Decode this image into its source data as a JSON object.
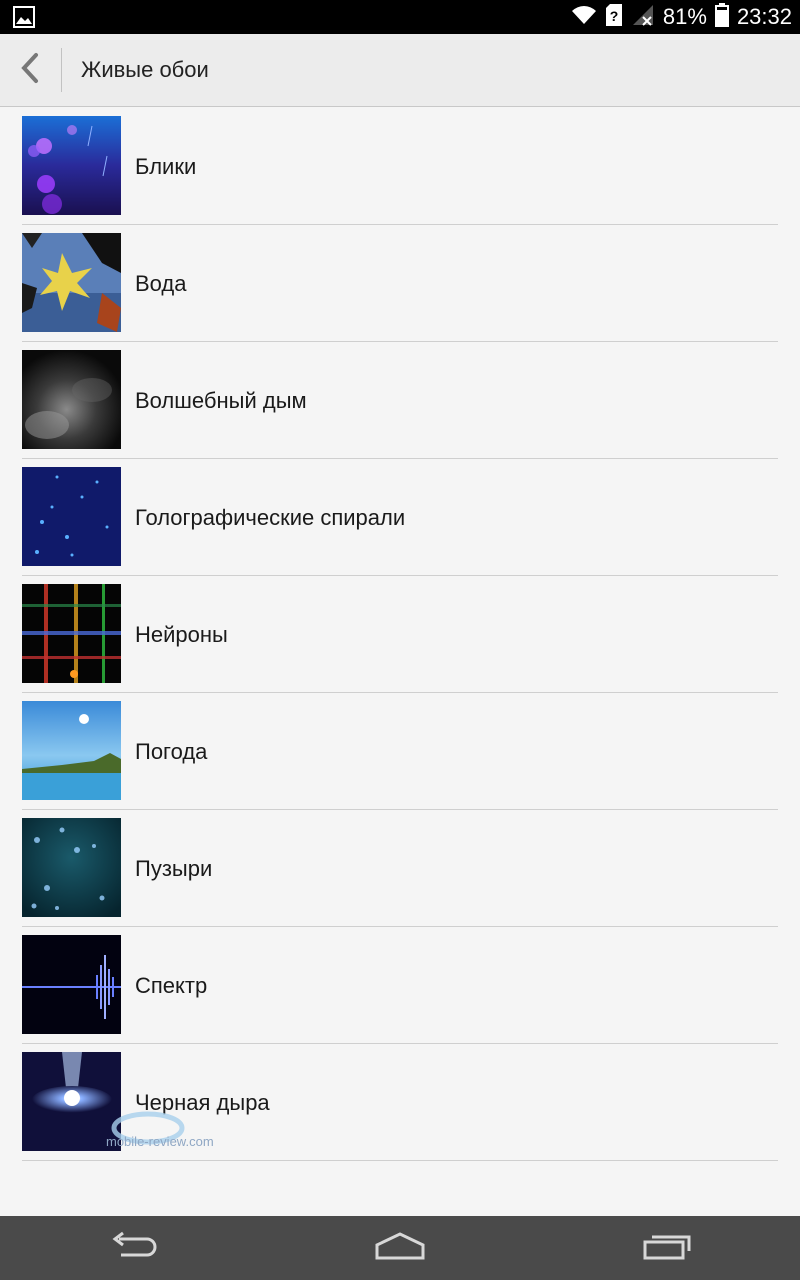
{
  "status_bar": {
    "battery_percent": "81%",
    "time": "23:32",
    "icons": [
      "image-notification-icon",
      "wifi-icon",
      "sim-unknown-icon",
      "signal-no-service-icon",
      "battery-icon"
    ]
  },
  "action_bar": {
    "title": "Живые обои",
    "back_icon": "chevron-left-icon"
  },
  "wallpapers": [
    {
      "label": "Блики"
    },
    {
      "label": "Вода"
    },
    {
      "label": "Волшебный дым"
    },
    {
      "label": "Голографические спирали"
    },
    {
      "label": "Нейроны"
    },
    {
      "label": "Погода"
    },
    {
      "label": "Пузыри"
    },
    {
      "label": "Спектр"
    },
    {
      "label": "Черная дыра"
    }
  ],
  "watermark": {
    "text": "mobile-review.com"
  },
  "nav_bar": {
    "icons": [
      "back-icon",
      "home-icon",
      "recent-apps-icon"
    ]
  },
  "colors": {
    "status_bar": "#000000",
    "action_bar": "#ececec",
    "background": "#f5f5f5",
    "nav_bar": "#4a4a4a"
  }
}
